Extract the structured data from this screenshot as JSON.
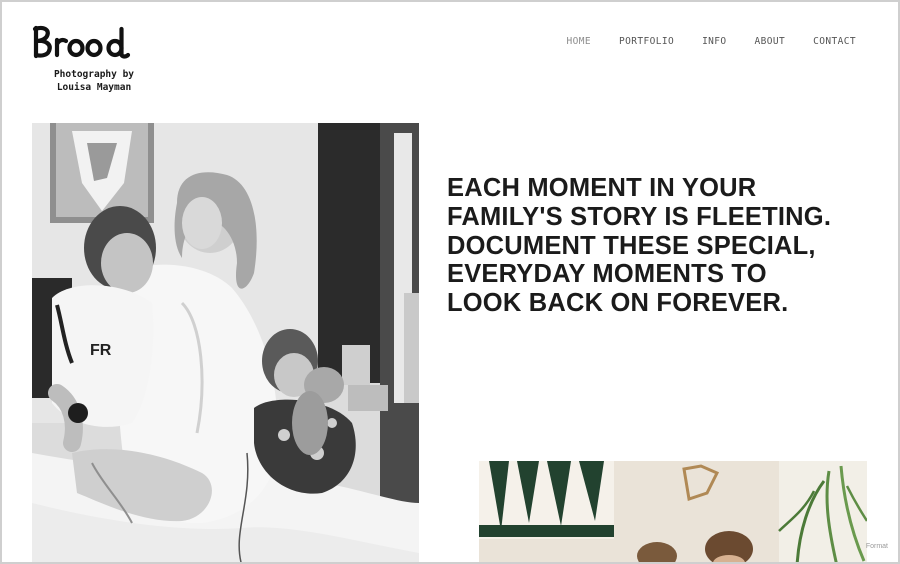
{
  "brand": {
    "name": "Brood",
    "tagline_line1": "Photography by",
    "tagline_line2": "Louisa Mayman"
  },
  "nav": {
    "items": [
      {
        "label": "HOME",
        "active": true
      },
      {
        "label": "PORTFOLIO",
        "active": false
      },
      {
        "label": "INFO",
        "active": false
      },
      {
        "label": "ABOUT",
        "active": false
      },
      {
        "label": "CONTACT",
        "active": false
      }
    ]
  },
  "hero": {
    "headline": "EACH MOMENT IN YOUR FAMILY'S STORY IS FLEETING. DOCUMENT THESE SPECIAL, EVERYDAY MOMENTS TO LOOK BACK ON FOREVER.",
    "photo_kid_shirt_text": "FR"
  },
  "footer": {
    "badge": "Format"
  },
  "colors": {
    "text": "#1b1b1b",
    "nav": "#555555",
    "nav_active": "#8c8c8c"
  }
}
